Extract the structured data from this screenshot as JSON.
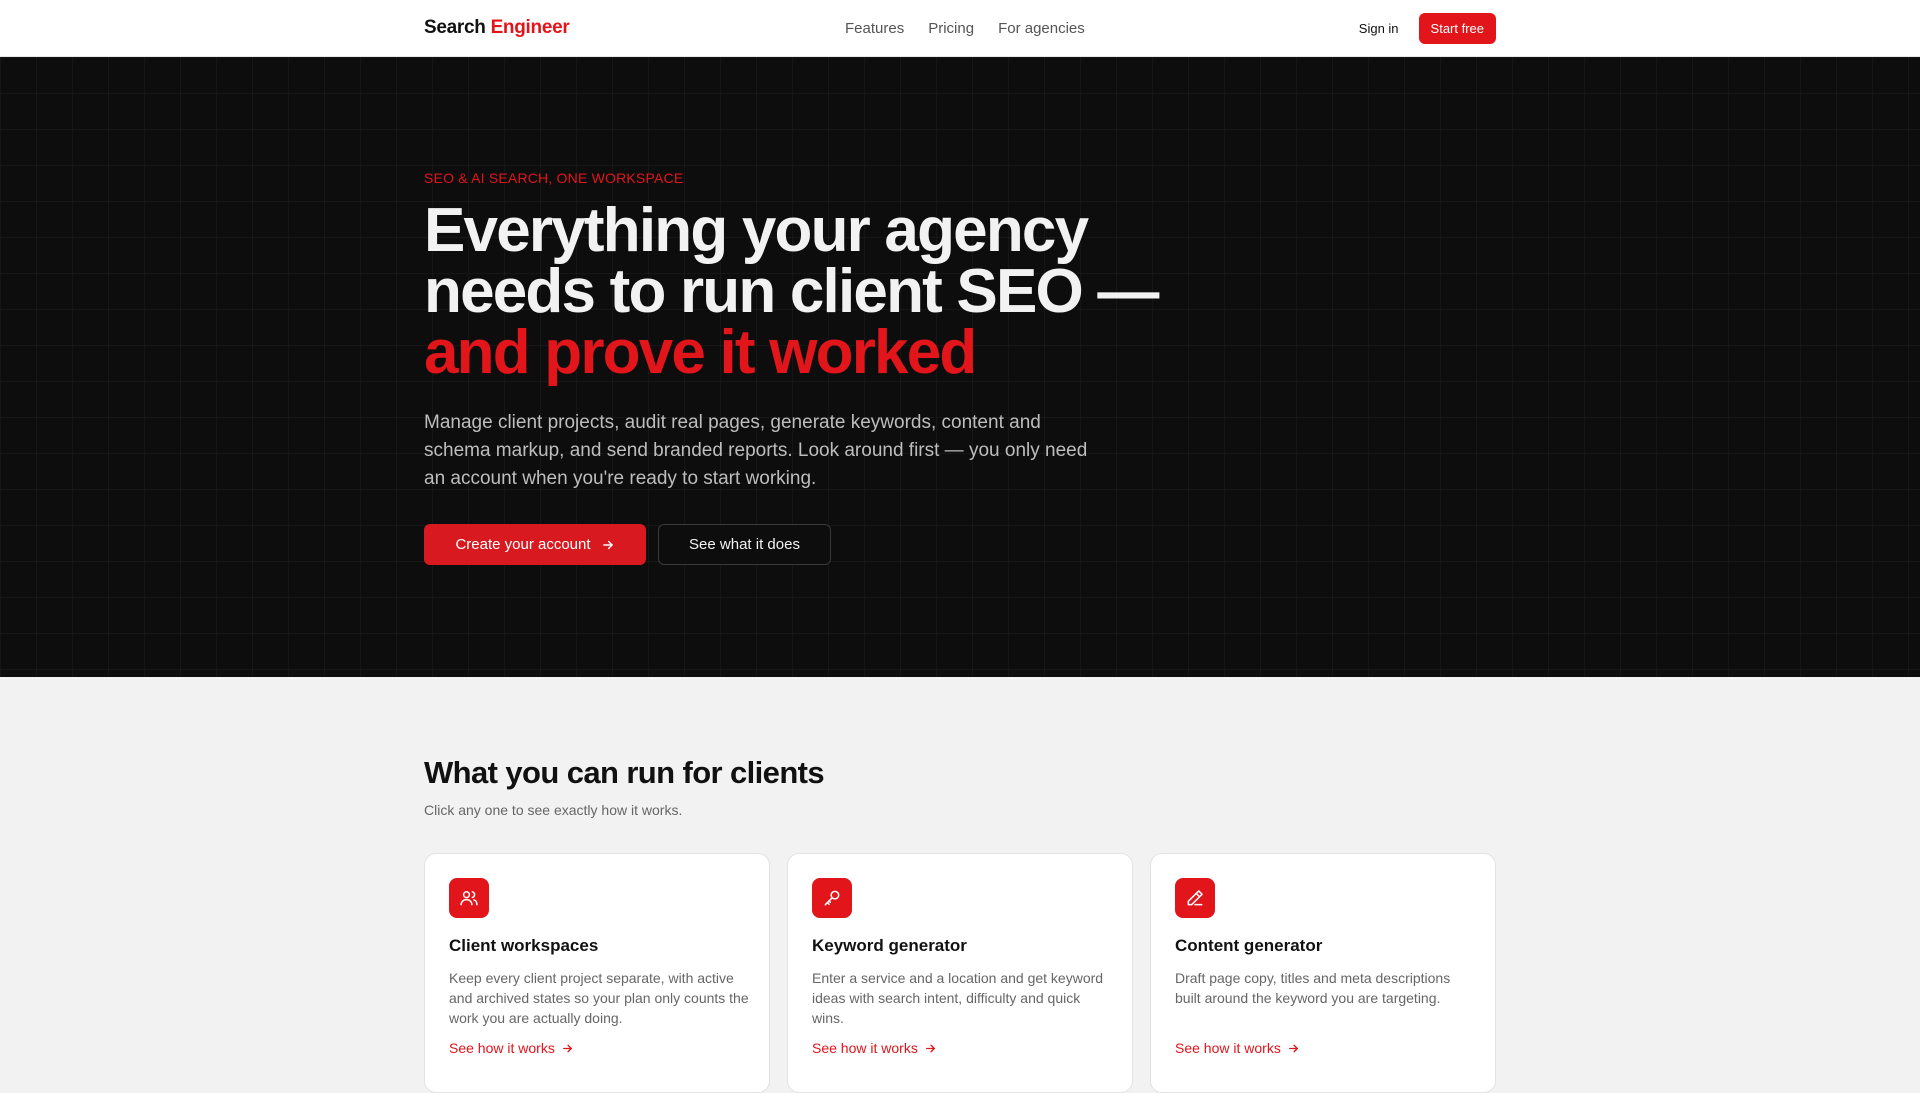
{
  "nav": {
    "brand_part1": "Search",
    "brand_part2": "Engineer",
    "links": [
      "Features",
      "Pricing",
      "For agencies"
    ],
    "sign_in": "Sign in",
    "start_free": "Start free"
  },
  "hero": {
    "eyebrow": "SEO & AI SEARCH, ONE WORKSPACE",
    "headline_line1": "Everything your agency",
    "headline_line2": "needs to run client SEO —",
    "headline_line3": "and prove it worked",
    "lead": "Manage client projects, audit real pages, generate keywords, content and schema markup, and send branded reports. Look around first — you only need an account when you're ready to start working.",
    "primary_cta": "Create your account",
    "secondary_cta": "See what it does"
  },
  "features": {
    "title": "What you can run for clients",
    "subtitle": "Click any one to see exactly how it works.",
    "cards": [
      {
        "icon": "users-icon",
        "title": "Client workspaces",
        "description": "Keep every client project separate, with active and archived states so your plan only counts the work you are actually doing.",
        "link": "See how it works"
      },
      {
        "icon": "key-icon",
        "title": "Keyword generator",
        "description": "Enter a service and a location and get keyword ideas with search intent, difficulty and quick wins.",
        "link": "See how it works"
      },
      {
        "icon": "pencil-icon",
        "title": "Content generator",
        "description": "Draft page copy, titles and meta descriptions built around the keyword you are targeting.",
        "link": "See how it works"
      }
    ]
  },
  "colors": {
    "accent": "#e2151b",
    "hero_background": "#0d0d0d",
    "page_background": "#f2f2f2"
  }
}
